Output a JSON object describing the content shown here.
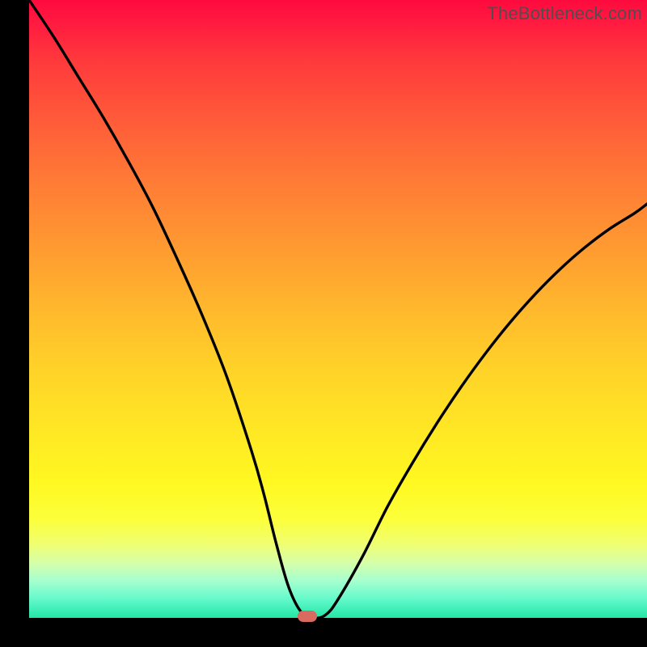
{
  "watermark": "TheBottleneck.com",
  "colors": {
    "curve_stroke": "#000000",
    "marker_fill": "#d86a60",
    "frame_background": "#000000"
  },
  "chart_data": {
    "type": "line",
    "title": "",
    "xlabel": "",
    "ylabel": "",
    "xlim": [
      0,
      100
    ],
    "ylim": [
      0,
      100
    ],
    "grid": false,
    "legend": false,
    "series": [
      {
        "name": "bottleneck-curve",
        "x": [
          0,
          4,
          8,
          12,
          16,
          20,
          24,
          28,
          32,
          36,
          38,
          40,
          42,
          44,
          46,
          48,
          50,
          54,
          58,
          62,
          66,
          70,
          74,
          78,
          82,
          86,
          90,
          94,
          98,
          100
        ],
        "y": [
          100,
          94,
          87.5,
          81,
          74,
          66.5,
          58,
          49,
          39,
          27,
          20,
          12,
          5,
          1,
          0,
          0.5,
          3,
          10,
          18,
          25,
          31.5,
          37.5,
          43,
          48,
          52.5,
          56.5,
          60,
          63,
          65.5,
          67
        ]
      }
    ],
    "annotations": [
      {
        "name": "min-marker",
        "x": 45,
        "y": 0
      }
    ]
  }
}
